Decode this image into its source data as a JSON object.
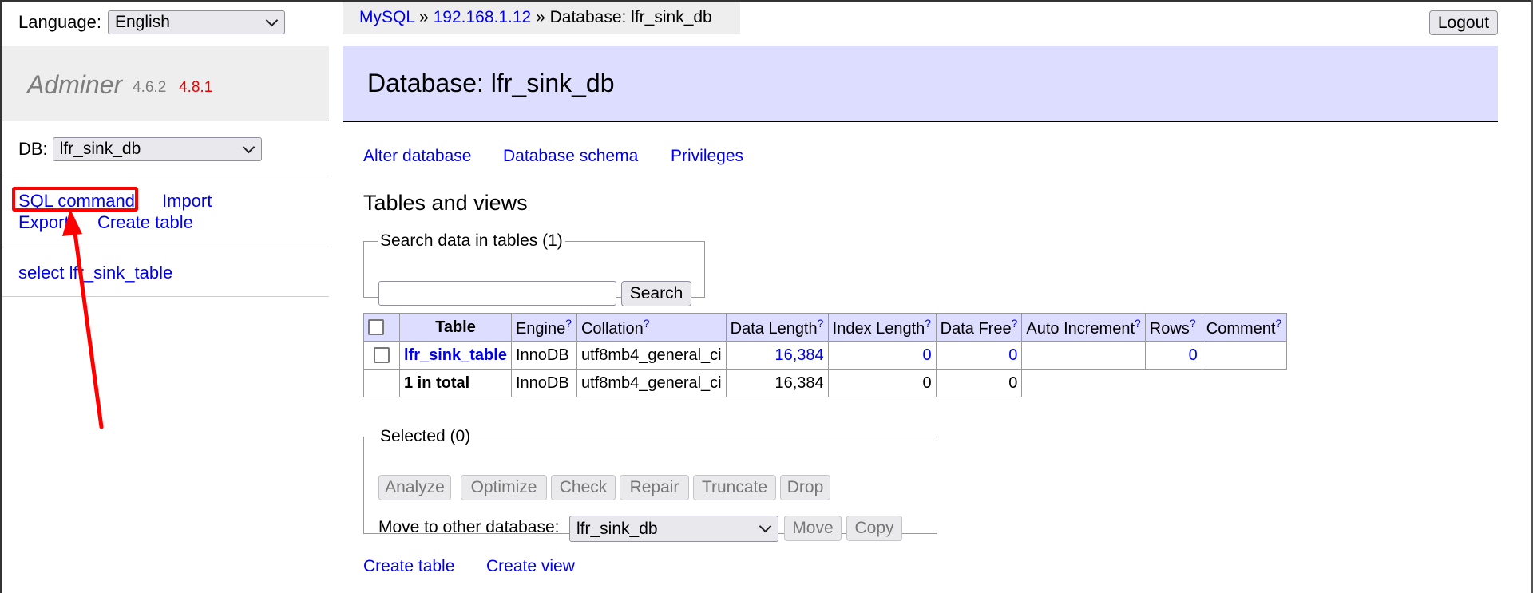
{
  "sidebar": {
    "language_label": "Language:",
    "language_value": "English",
    "logo": {
      "name": "Adminer",
      "version_old": "4.6.2",
      "version_new": "4.8.1"
    },
    "db_label": "DB:",
    "db_value": "lfr_sink_db",
    "links": {
      "sql_command": "SQL command",
      "import": "Import",
      "export": "Export",
      "create_table": "Create table"
    },
    "tables": [
      "select lfr_sink_table"
    ]
  },
  "breadcrumb": {
    "system": "MySQL",
    "sep1": "»",
    "server": "192.168.1.12",
    "sep2": "»",
    "current": "Database: lfr_sink_db"
  },
  "logout_label": "Logout",
  "header": {
    "title": "Database: lfr_sink_db"
  },
  "db_links": {
    "alter": "Alter database",
    "schema": "Database schema",
    "privileges": "Privileges"
  },
  "tables_heading": "Tables and views",
  "search": {
    "legend": "Search data in tables (1)",
    "value": "",
    "button": "Search"
  },
  "table": {
    "help_mark": "?",
    "columns": [
      "Table",
      "Engine",
      "Collation",
      "Data Length",
      "Index Length",
      "Data Free",
      "Auto Increment",
      "Rows",
      "Comment"
    ],
    "rows": [
      {
        "name": "lfr_sink_table",
        "engine": "InnoDB",
        "collation": "utf8mb4_general_ci",
        "data_length": "16,384",
        "index_length": "0",
        "data_free": "0",
        "auto_increment": "",
        "rows": "0",
        "comment": ""
      }
    ],
    "total": {
      "label": "1 in total",
      "engine": "InnoDB",
      "collation": "utf8mb4_general_ci",
      "data_length": "16,384",
      "index_length": "0",
      "data_free": "0"
    }
  },
  "selected": {
    "legend": "Selected (0)",
    "buttons": [
      "Analyze",
      "Optimize",
      "Check",
      "Repair",
      "Truncate",
      "Drop"
    ],
    "move_label": "Move to other database:",
    "move_value": "lfr_sink_db",
    "move_button": "Move",
    "copy_button": "Copy"
  },
  "bottom_links": {
    "create_table": "Create table",
    "create_view": "Create view"
  },
  "colors": {
    "link": "#0000ee",
    "header_bg": "#ddddff",
    "highlight": "#ff0000",
    "version_new": "#ee0000"
  }
}
